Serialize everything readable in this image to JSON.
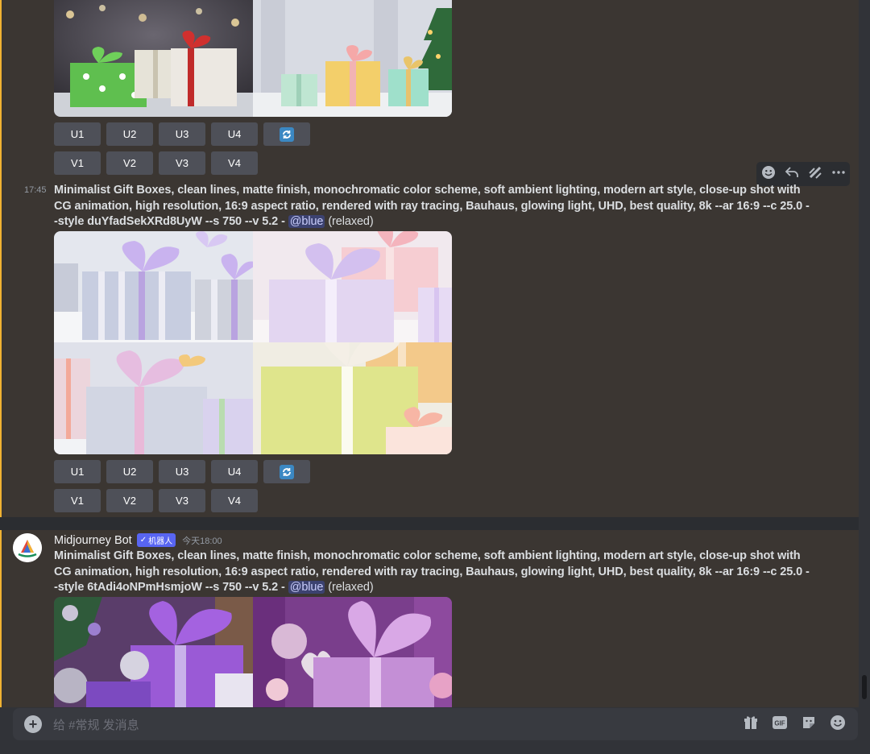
{
  "colors": {
    "background": "#313338",
    "highlight": "#3b3632",
    "highlight_border": "#f0b232",
    "button": "#4e5058",
    "mention_bg": "#3c4270",
    "bot_tag": "#5865f2"
  },
  "first_message": {
    "buttons_row1": [
      "U1",
      "U2",
      "U3",
      "U4"
    ],
    "buttons_row2": [
      "V1",
      "V2",
      "V3",
      "V4"
    ],
    "reroll_icon": "refresh-icon"
  },
  "hover_actions": [
    "add-reaction-icon",
    "reply-icon",
    "apps-icon",
    "more-icon"
  ],
  "second_message": {
    "timestamp": "17:45",
    "prompt": "Minimalist Gift Boxes, clean lines, matte finish, monochromatic color scheme, soft ambient lighting, modern art style, close-up shot with CG animation, high resolution, 16:9 aspect ratio, rendered with ray tracing, Bauhaus, glowing light, UHD, best quality, 8k --ar 16:9 --c 25.0 --style duYfadSekXRd8UyW --s 750 --v 5.2 -",
    "mention": "@blue",
    "suffix": "(relaxed)",
    "buttons_row1": [
      "U1",
      "U2",
      "U3",
      "U4"
    ],
    "buttons_row2": [
      "V1",
      "V2",
      "V3",
      "V4"
    ]
  },
  "third_message": {
    "author": "Midjourney Bot",
    "bot_tag": "机器人",
    "time": "今天18:00",
    "prompt": "Minimalist Gift Boxes, clean lines, matte finish, monochromatic color scheme, soft ambient lighting, modern art style, close-up shot with CG animation, high resolution, 16:9 aspect ratio, rendered with ray tracing, Bauhaus, glowing light, UHD, best quality, 8k --ar 16:9 --c 25.0 --style 6tAdi4oNPmHsmjoW --s 750 --v 5.2 -",
    "mention": "@blue",
    "suffix": "(relaxed)"
  },
  "composer": {
    "placeholder": "给 #常规 发消息",
    "gif_label": "GIF"
  }
}
